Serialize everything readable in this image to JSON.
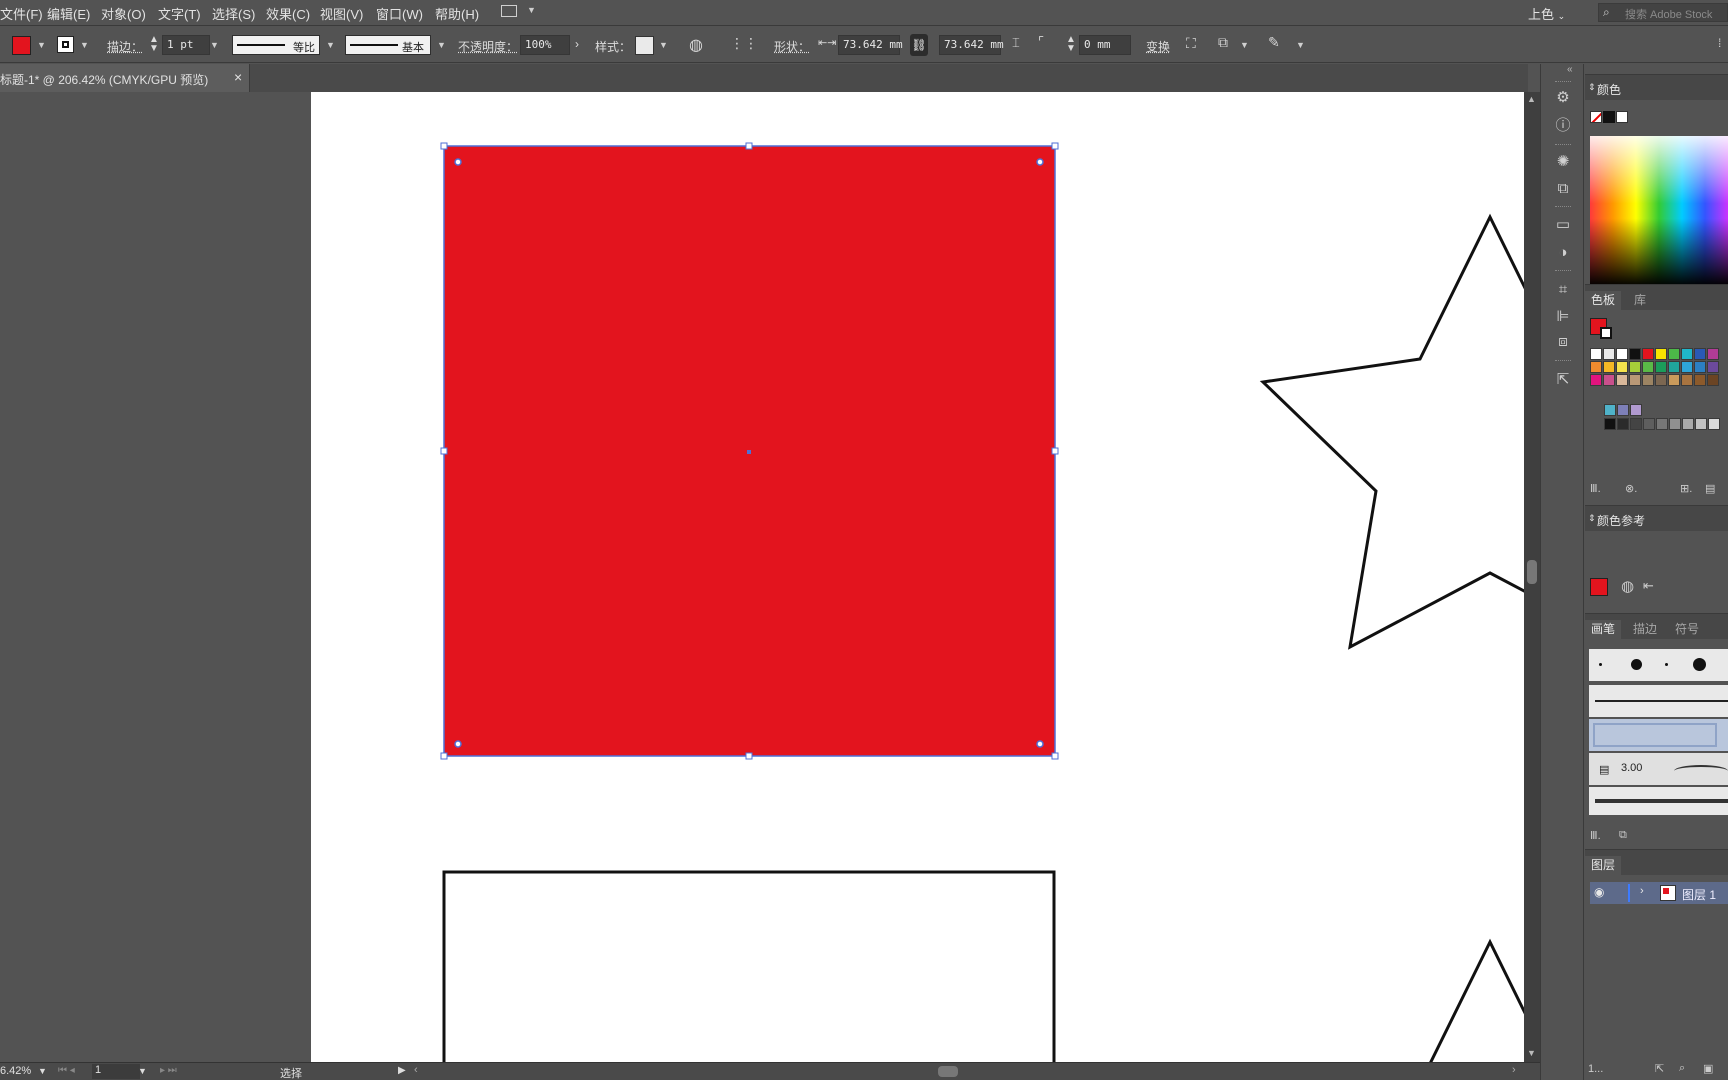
{
  "menu": [
    "文件(F)",
    "编辑(E)",
    "对象(O)",
    "文字(T)",
    "选择(S)",
    "效果(C)",
    "视图(V)",
    "窗口(W)",
    "帮助(H)"
  ],
  "workspace": "上色",
  "stock_search_placeholder": "搜索 Adobe Stock",
  "control": {
    "stroke_label": "描边：",
    "stroke_weight": "1 pt",
    "profile_label": "等比",
    "brush_label": "基本",
    "opacity_label": "不透明度：",
    "opacity_value": "100%",
    "style_label": "样式：",
    "shape_label": "形状：",
    "width_value": "73.642 mm",
    "height_value": "73.642 mm",
    "corner_value": "0 mm",
    "transform_label": "变换"
  },
  "colors": {
    "fill": "#e3141e",
    "accent": "#4f6fd6"
  },
  "document": {
    "tab_title": "标题-1* @ 206.42% (CMYK/GPU 预览)",
    "close_glyph": "×"
  },
  "status": {
    "zoom": "6.42%",
    "page": "1",
    "tool": "选择"
  },
  "panels": {
    "color_title": "颜色",
    "swatches_tab": "色板",
    "library_tab": "库",
    "color_guide_title": "颜色参考",
    "brushes_tab": "画笔",
    "stroke_tab": "描边",
    "symbols_tab": "符号",
    "brush_size": "3.00",
    "layers_title": "图层",
    "layer_name": "图层 1",
    "footer_value": "1..."
  }
}
